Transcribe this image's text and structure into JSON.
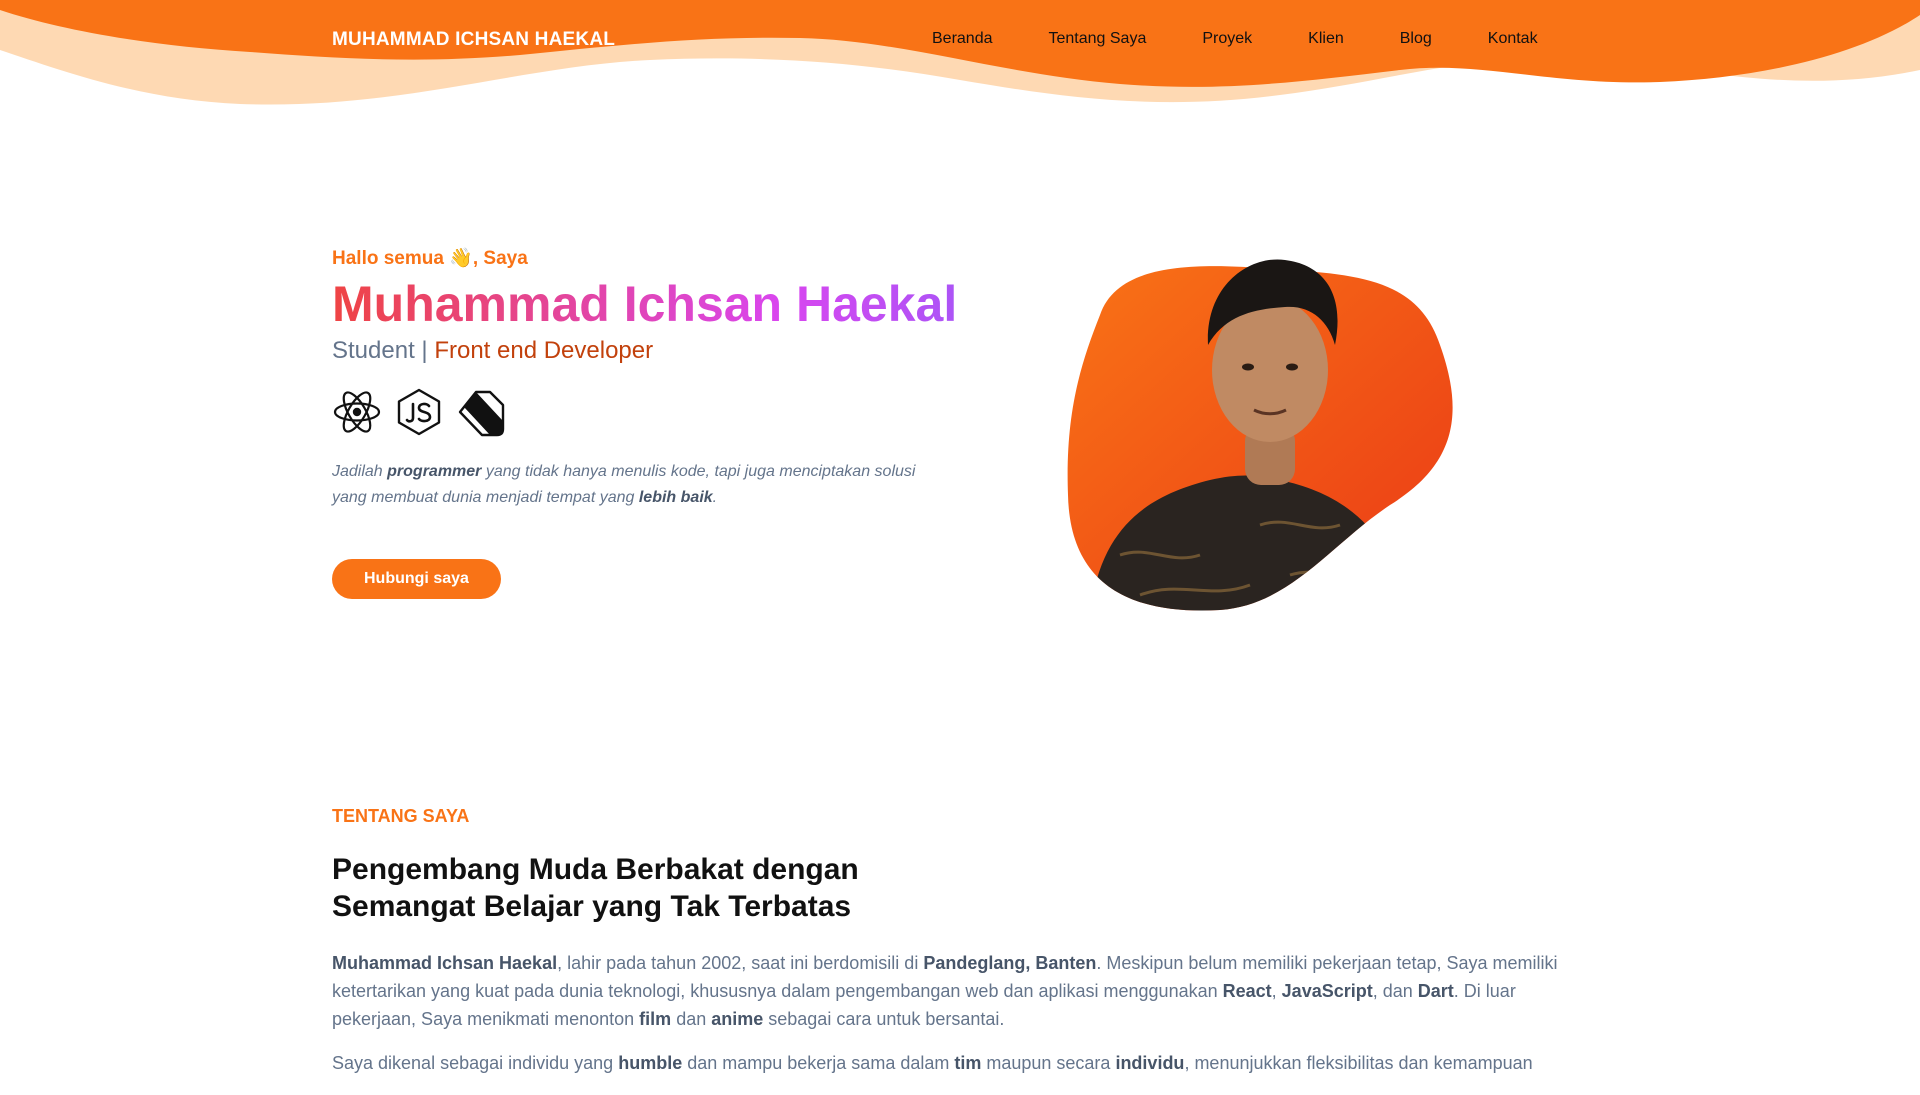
{
  "header": {
    "brand": "MUHAMMAD ICHSAN HAEKAL",
    "nav": [
      "Beranda",
      "Tentang Saya",
      "Proyek",
      "Klien",
      "Blog",
      "Kontak"
    ]
  },
  "hero": {
    "greeting": "Hallo semua 👋, Saya",
    "name": "Muhammad Ichsan Haekal",
    "role_a": "Student",
    "role_sep": " | ",
    "role_b": "Front end Developer",
    "tech_icons": [
      "react-icon",
      "nodejs-icon",
      "dart-icon"
    ],
    "quote": {
      "p1": "Jadilah ",
      "b1": "programmer",
      "p2": " yang tidak hanya menulis kode, tapi juga menciptakan solusi yang membuat dunia menjadi tempat yang ",
      "b2": "lebih baik",
      "p3": "."
    },
    "cta_label": "Hubungi saya"
  },
  "about": {
    "label": "TENTANG SAYA",
    "title": "Pengembang Muda Berbakat dengan Semangat Belajar yang Tak Terbatas",
    "para1": {
      "b1": "Muhammad Ichsan Haekal",
      "t1": ", lahir pada tahun 2002, saat ini berdomisili di ",
      "b2": "Pandeglang, Banten",
      "t2": ". Meskipun belum memiliki pekerjaan tetap, Saya memiliki ketertarikan yang kuat pada dunia teknologi, khususnya dalam pengembangan web dan aplikasi menggunakan ",
      "b3": "React",
      "t3": ", ",
      "b4": "JavaScript",
      "t4": ", dan ",
      "b5": "Dart",
      "t5": ". Di luar pekerjaan, Saya menikmati menonton ",
      "b6": "film",
      "t6": " dan ",
      "b7": "anime",
      "t7": " sebagai cara untuk bersantai."
    },
    "para2": {
      "t1": "Saya dikenal sebagai individu yang ",
      "b1": "humble",
      "t2": " dan mampu bekerja sama dalam ",
      "b2": "tim",
      "t3": " maupun secara ",
      "b3": "individu",
      "t4": ", menunjukkan fleksibilitas dan kemampuan"
    }
  },
  "colors": {
    "accent": "#f97316",
    "wave_dark": "#f97316",
    "wave_light": "#fdba74",
    "name_gradient_start": "#ef4444",
    "name_gradient_end": "#a855f7",
    "role_accent": "#c2410c"
  }
}
